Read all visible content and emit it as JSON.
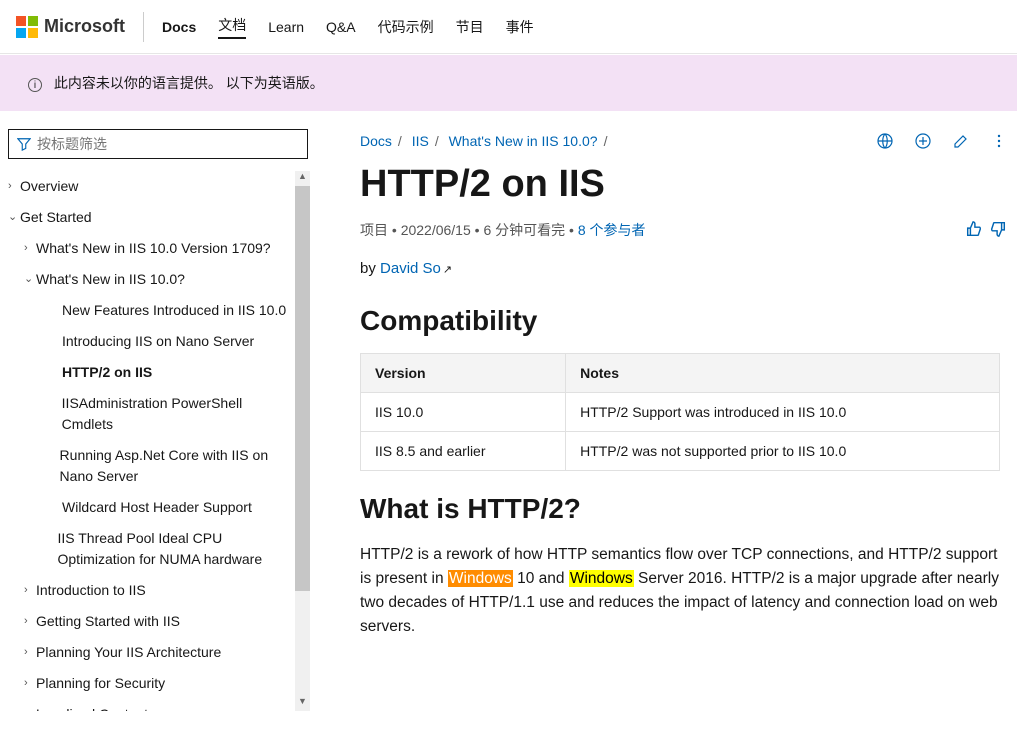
{
  "header": {
    "brand": "Microsoft",
    "product": "Docs",
    "nav": [
      "文档",
      "Learn",
      "Q&A",
      "代码示例",
      "节目",
      "事件"
    ]
  },
  "banner": "此内容未以你的语言提供。 以下为英语版。",
  "sidebar": {
    "filter_placeholder": "按标题筛选",
    "items": [
      {
        "label": "Overview",
        "lvl": 0,
        "caret": "›"
      },
      {
        "label": "Get Started",
        "lvl": 0,
        "caret": "⌄"
      },
      {
        "label": "What's New in IIS 10.0 Version 1709?",
        "lvl": 1,
        "caret": "›"
      },
      {
        "label": "What's New in IIS 10.0?",
        "lvl": 1,
        "caret": "⌄"
      },
      {
        "label": "New Features Introduced in IIS 10.0",
        "lvl": 2,
        "caret": ""
      },
      {
        "label": "Introducing IIS on Nano Server",
        "lvl": 2,
        "caret": ""
      },
      {
        "label": "HTTP/2 on IIS",
        "lvl": 2,
        "caret": "",
        "selected": true
      },
      {
        "label": "IISAdministration PowerShell Cmdlets",
        "lvl": 2,
        "caret": ""
      },
      {
        "label": "Running Asp.Net Core with IIS on Nano Server",
        "lvl": 2,
        "caret": ""
      },
      {
        "label": "Wildcard Host Header Support",
        "lvl": 2,
        "caret": ""
      },
      {
        "label": "IIS Thread Pool Ideal CPU Optimization for NUMA hardware",
        "lvl": 2,
        "caret": ""
      },
      {
        "label": "Introduction to IIS",
        "lvl": 1,
        "caret": "›"
      },
      {
        "label": "Getting Started with IIS",
        "lvl": 1,
        "caret": "›"
      },
      {
        "label": "Planning Your IIS Architecture",
        "lvl": 1,
        "caret": "›"
      },
      {
        "label": "Planning for Security",
        "lvl": 1,
        "caret": "›"
      },
      {
        "label": "Localized Content",
        "lvl": 1,
        "caret": "›"
      }
    ]
  },
  "breadcrumb": [
    "Docs",
    "IIS",
    "What's New in IIS 10.0?"
  ],
  "page": {
    "title": "HTTP/2 on IIS",
    "meta_prefix": "项目",
    "date": "2022/06/15",
    "readtime": "6 分钟可看完",
    "contributors": "8 个参与者",
    "by_label": "by ",
    "author": "David So"
  },
  "section_compat": {
    "heading": "Compatibility",
    "headers": [
      "Version",
      "Notes"
    ],
    "rows": [
      [
        "IIS 10.0",
        "HTTP/2 Support was introduced in IIS 10.0"
      ],
      [
        "IIS 8.5 and earlier",
        "HTTP/2 was not supported prior to IIS 10.0"
      ]
    ]
  },
  "section_what": {
    "heading": "What is HTTP/2?",
    "para_pre": "HTTP/2 is a rework of how HTTP semantics flow over TCP connections, and HTTP/2 support is present in ",
    "hl1": "Windows",
    "mid1": " 10 and ",
    "hl2": "Windows",
    "para_post": " Server 2016. HTTP/2 is a major upgrade after nearly two decades of HTTP/1.1 use and reduces the impact of latency and connection load on web servers."
  }
}
